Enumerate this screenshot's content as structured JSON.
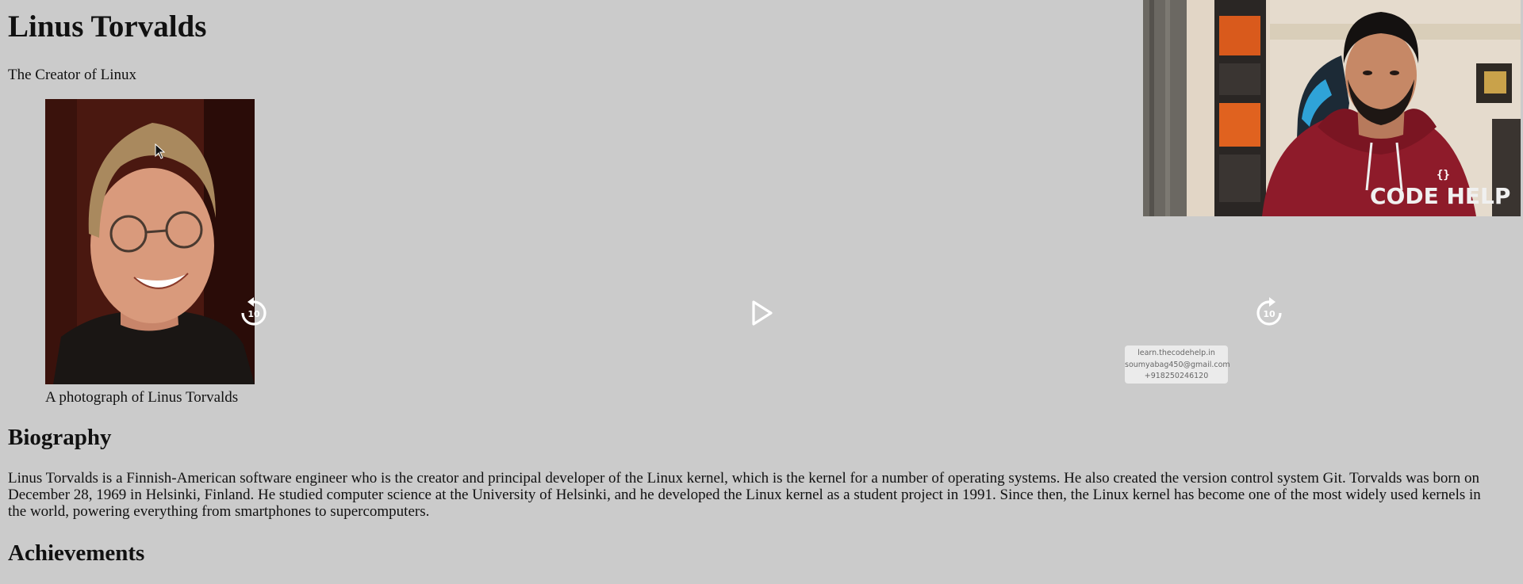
{
  "page": {
    "title": "Linus Torvalds",
    "subtitle": "The Creator of Linux",
    "figure": {
      "caption": "A photograph of Linus Torvalds"
    },
    "biography": {
      "heading": "Biography",
      "text": "Linus Torvalds is a Finnish-American software engineer who is the creator and principal developer of the Linux kernel, which is the kernel for a number of operating systems. He also created the version control system Git. Torvalds was born on December 28, 1969 in Helsinki, Finland. He studied computer science at the University of Helsinki, and he developed the Linux kernel as a student project in 1991. Since then, the Linux kernel has become one of the most widely used kernels in the world, powering everything from smartphones to supercomputers."
    },
    "achievements": {
      "heading": "Achievements"
    }
  },
  "player": {
    "rewind_seconds": "10",
    "forward_seconds": "10",
    "icons": {
      "rewind": "rewind-10-icon",
      "play": "play-icon",
      "forward": "forward-10-icon"
    }
  },
  "watermark": {
    "site": "learn.thecodehelp.in",
    "email": "soumyabag450@gmail.com",
    "phone": "+918250246120"
  },
  "webcam": {
    "hoodie_text": "CODE HELP"
  },
  "colors": {
    "background": "#cbcbcb",
    "hoodie": "#8e1b2a"
  }
}
